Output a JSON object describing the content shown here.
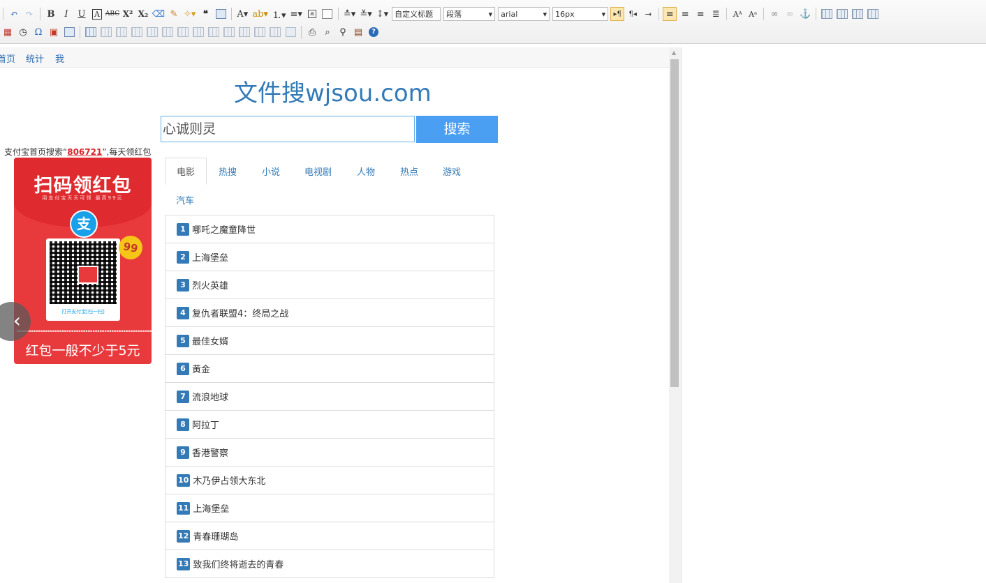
{
  "toolbar": {
    "font_style_select": "自定义标题",
    "paragraph_select": "段落",
    "font_family_select": "arial",
    "font_size_select": "16px",
    "accent": "#fde7b0"
  },
  "nav": {
    "items": [
      "首页",
      "统计",
      "我"
    ]
  },
  "site": {
    "title": "文件搜wjsou.com"
  },
  "search": {
    "value": "心诚则灵",
    "button_label": "搜索"
  },
  "promo": {
    "prefix": "支付宝首页搜索“",
    "code": "806721",
    "suffix": "”,每天领红包"
  },
  "redpacket": {
    "heading": "扫码领红包",
    "subheading": "用支付宝天天可领 最高99元",
    "alipay_glyph": "支",
    "badge": "99",
    "qr_label": "打开支付宝[扫一扫]",
    "footer": "红包一般不少于5元"
  },
  "tabs": [
    "电影",
    "热搜",
    "小说",
    "电视剧",
    "人物",
    "热点",
    "游戏",
    "汽车"
  ],
  "list": [
    {
      "rank": "1",
      "title": "哪吒之魔童降世"
    },
    {
      "rank": "2",
      "title": "上海堡垒"
    },
    {
      "rank": "3",
      "title": "烈火英雄"
    },
    {
      "rank": "4",
      "title": "复仇者联盟4：终局之战"
    },
    {
      "rank": "5",
      "title": "最佳女婿"
    },
    {
      "rank": "6",
      "title": "黄金"
    },
    {
      "rank": "7",
      "title": "流浪地球"
    },
    {
      "rank": "8",
      "title": "阿拉丁"
    },
    {
      "rank": "9",
      "title": "香港警察"
    },
    {
      "rank": "10",
      "title": "木乃伊占领大东北"
    },
    {
      "rank": "11",
      "title": "上海堡垒"
    },
    {
      "rank": "12",
      "title": "青春珊瑚岛"
    },
    {
      "rank": "13",
      "title": "致我们终将逝去的青春"
    }
  ],
  "colors": {
    "link": "#337ab7",
    "search_button": "#4b9ff2",
    "red_packet": "#e83a3d",
    "promo_code": "#d9252b"
  }
}
